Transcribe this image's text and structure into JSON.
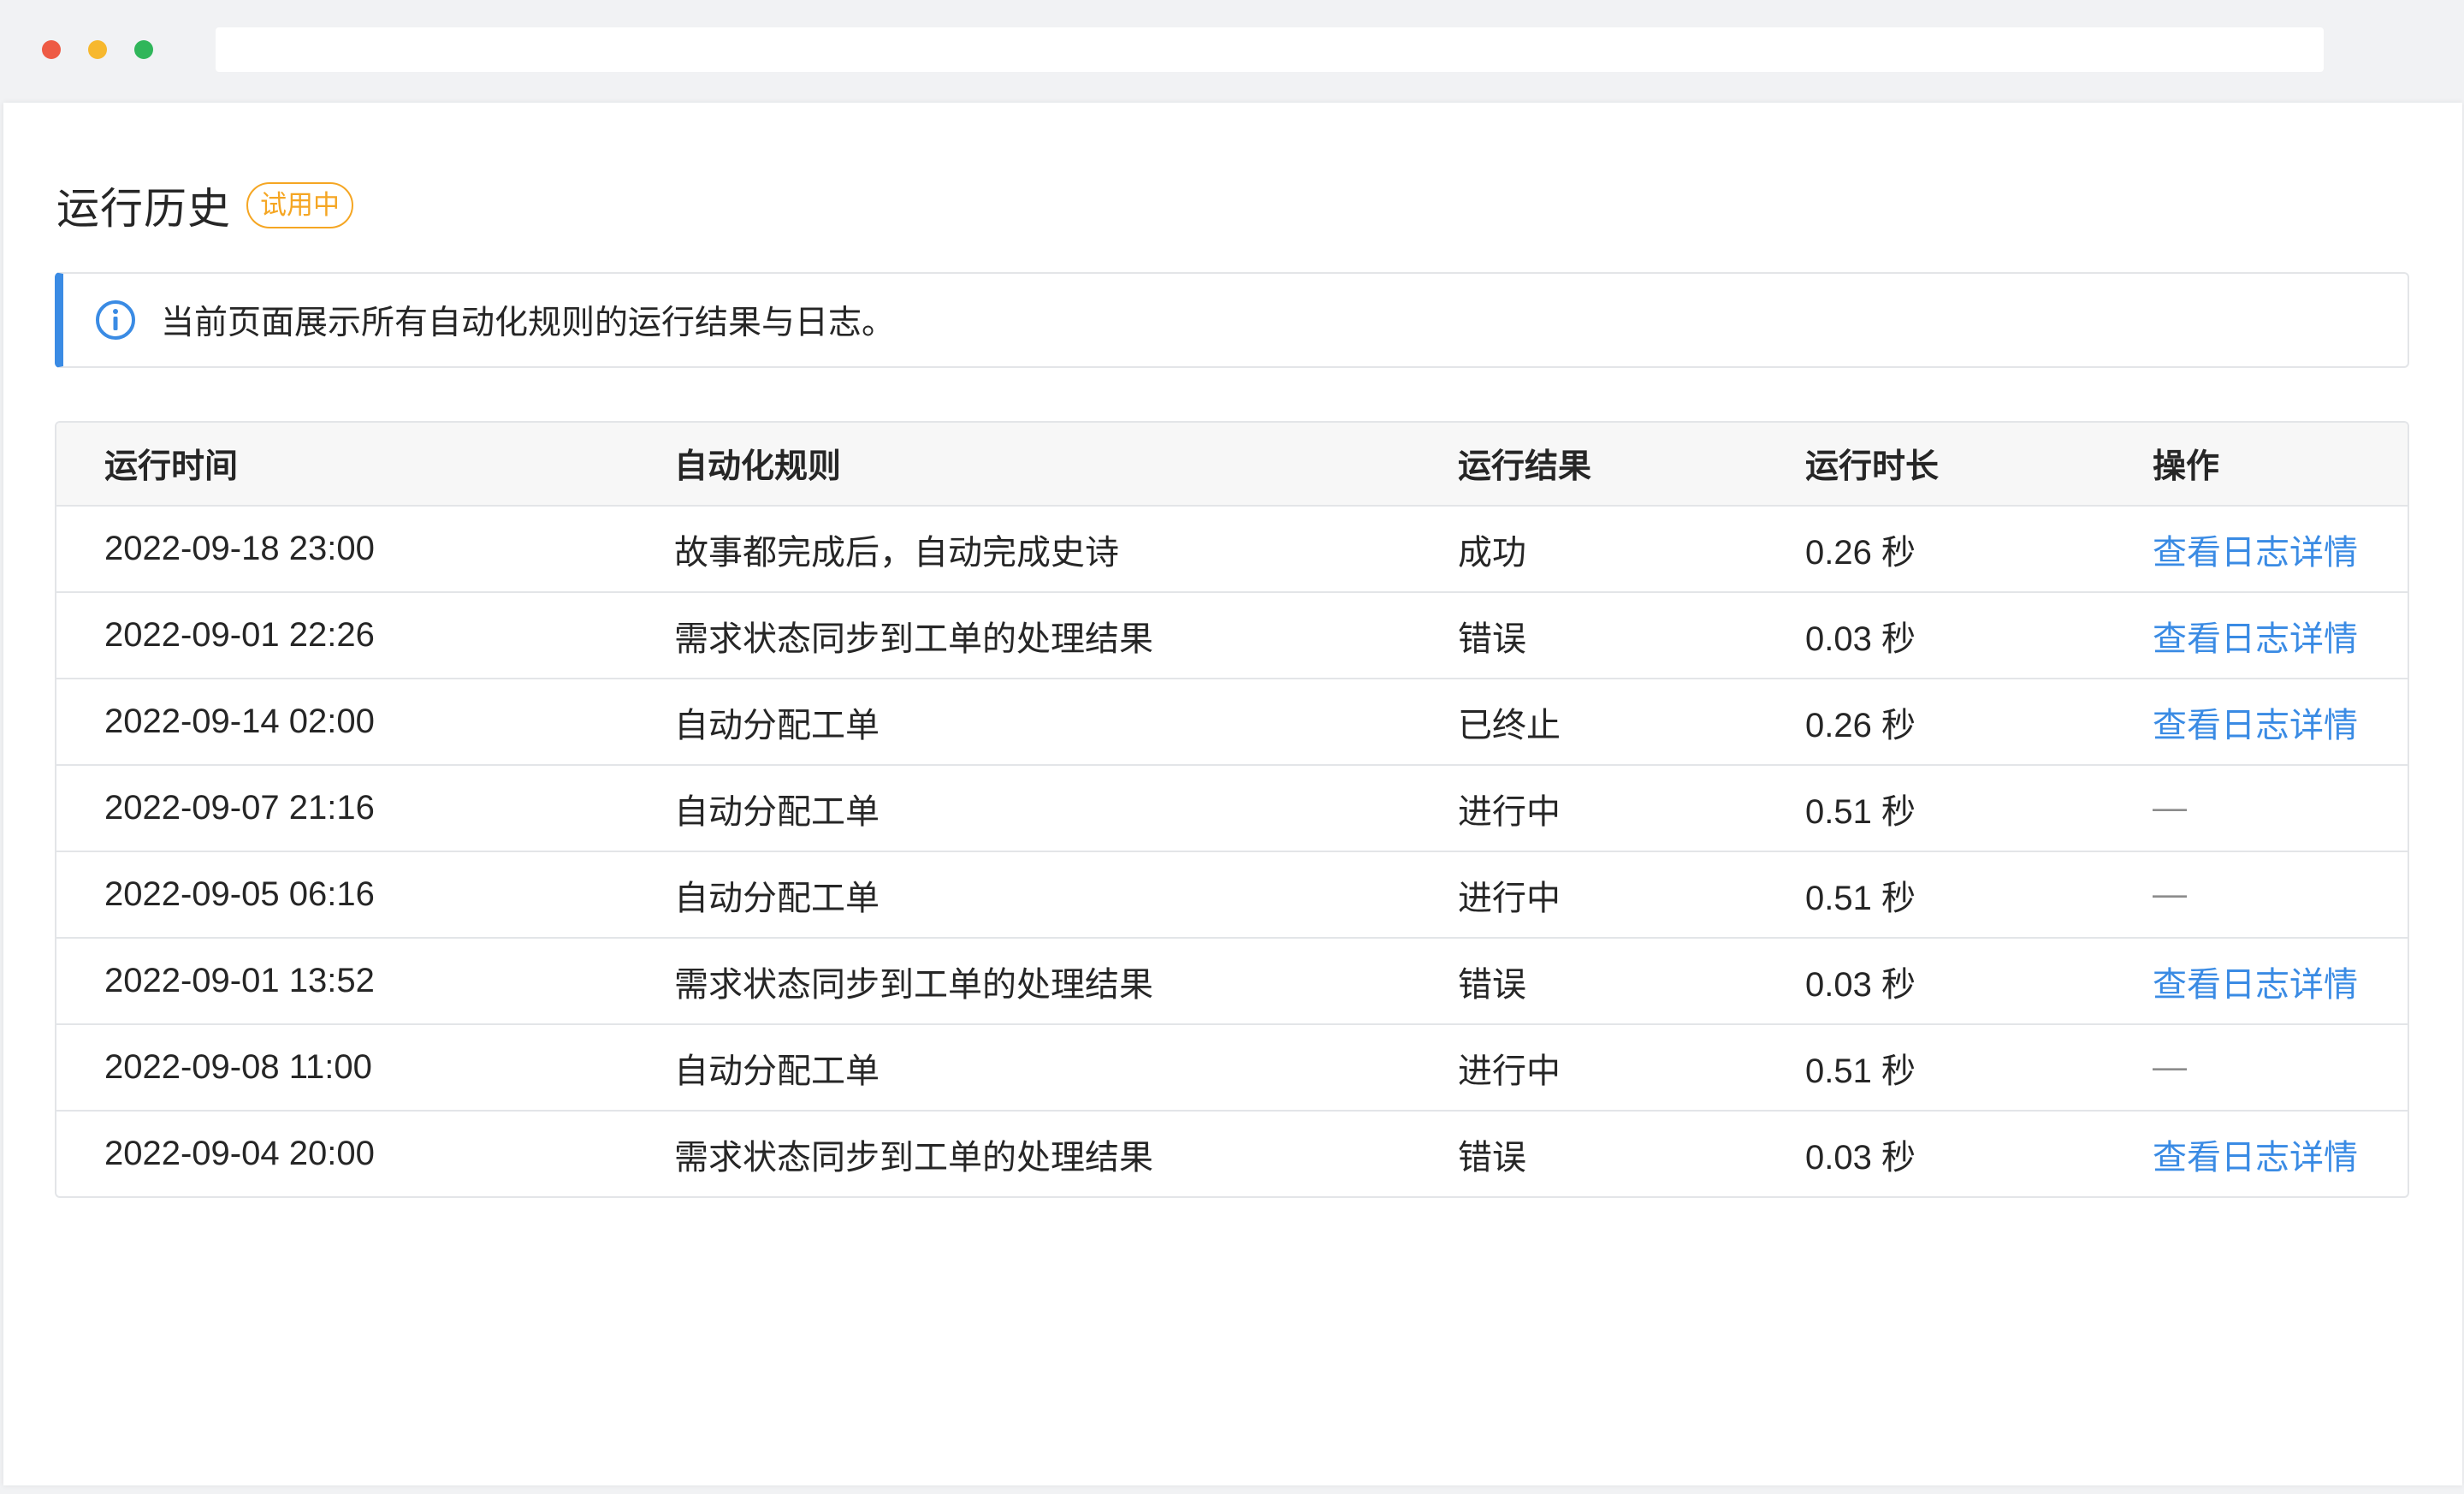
{
  "window": {
    "controls": [
      "close",
      "minimize",
      "maximize"
    ],
    "colors": {
      "close": "#ee5a44",
      "minimize": "#f7b82e",
      "maximize": "#30b65a"
    }
  },
  "page": {
    "title": "运行历史",
    "badge": "试用中",
    "badge_color": "#f5a623"
  },
  "alert": {
    "icon": "info-icon",
    "text": "当前页面展示所有自动化规则的运行结果与日志。",
    "accent_color": "#3a8be4"
  },
  "table": {
    "columns": [
      "运行时间",
      "自动化规则",
      "运行结果",
      "运行时长",
      "操作"
    ],
    "rows": [
      {
        "time": "2022-09-18 23:00",
        "rule": "故事都完成后，自动完成史诗",
        "result": "成功",
        "duration": "0.26 秒",
        "action": "查看日志详情"
      },
      {
        "time": "2022-09-01 22:26",
        "rule": "需求状态同步到工单的处理结果",
        "result": "错误",
        "duration": "0.03 秒",
        "action": "查看日志详情"
      },
      {
        "time": "2022-09-14 02:00",
        "rule": "自动分配工单",
        "result": "已终止",
        "duration": "0.26 秒",
        "action": "查看日志详情"
      },
      {
        "time": "2022-09-07 21:16",
        "rule": "自动分配工单",
        "result": "进行中",
        "duration": "0.51 秒",
        "action": "—"
      },
      {
        "time": "2022-09-05 06:16",
        "rule": "自动分配工单",
        "result": "进行中",
        "duration": "0.51 秒",
        "action": "—"
      },
      {
        "time": "2022-09-01 13:52",
        "rule": "需求状态同步到工单的处理结果",
        "result": "错误",
        "duration": "0.03 秒",
        "action": "查看日志详情"
      },
      {
        "time": "2022-09-08 11:00",
        "rule": "自动分配工单",
        "result": "进行中",
        "duration": "0.51 秒",
        "action": "—"
      },
      {
        "time": "2022-09-04 20:00",
        "rule": "需求状态同步到工单的处理结果",
        "result": "错误",
        "duration": "0.03 秒",
        "action": "查看日志详情"
      }
    ],
    "link_color": "#3a8be4"
  }
}
